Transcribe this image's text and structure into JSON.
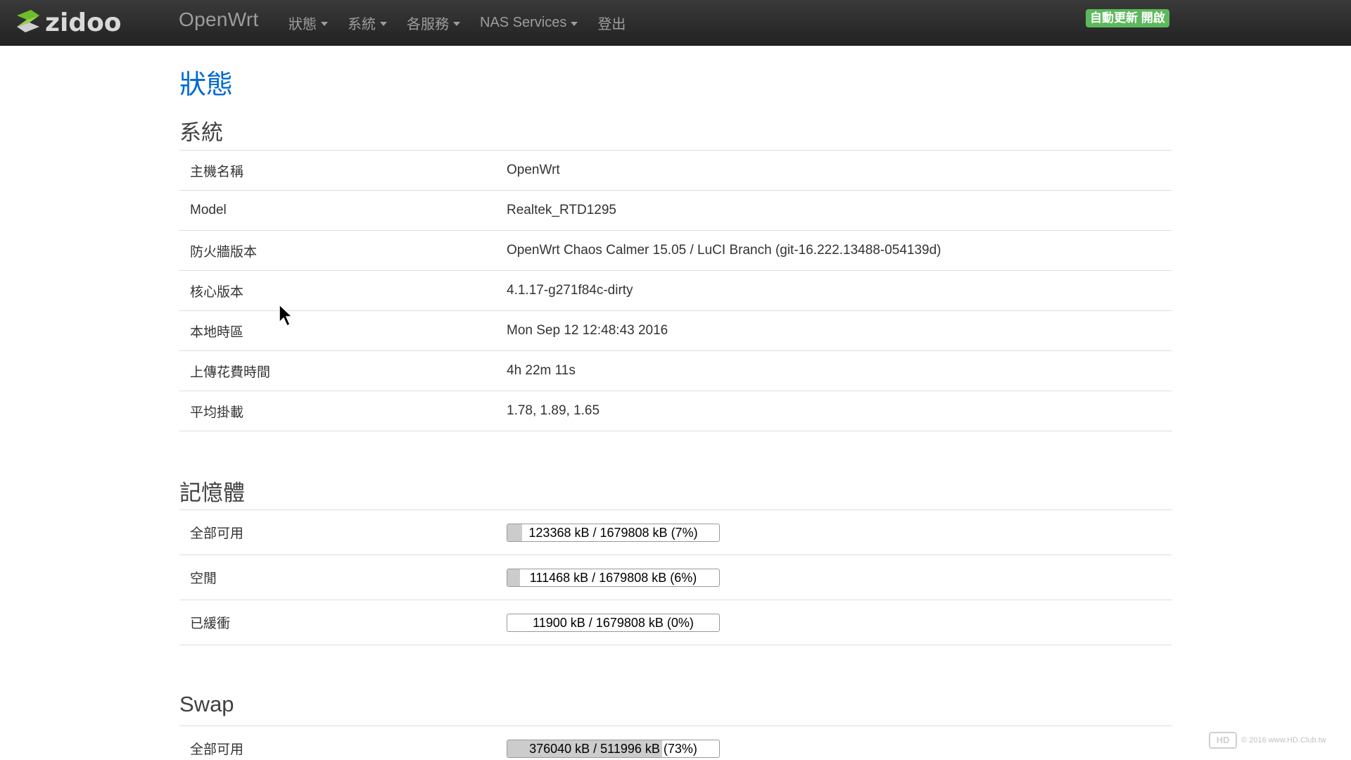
{
  "navbar": {
    "brand_logo_text": "zidoo",
    "brand_text": "OpenWrt",
    "menu": [
      {
        "label": "狀態",
        "has_caret": true
      },
      {
        "label": "系統",
        "has_caret": true
      },
      {
        "label": "各服務",
        "has_caret": true
      },
      {
        "label": "NAS Services",
        "has_caret": true
      },
      {
        "label": "登出",
        "has_caret": false
      }
    ],
    "auto_refresh_label": "自動更新 開啟"
  },
  "page": {
    "title": "狀態"
  },
  "system": {
    "title": "系統",
    "rows": [
      {
        "key": "主機名稱",
        "value": "OpenWrt"
      },
      {
        "key": "Model",
        "value": "Realtek_RTD1295"
      },
      {
        "key": "防火牆版本",
        "value": "OpenWrt Chaos Calmer 15.05 / LuCI Branch (git-16.222.13488-054139d)"
      },
      {
        "key": "核心版本",
        "value": "4.1.17-g271f84c-dirty"
      },
      {
        "key": "本地時區",
        "value": "Mon Sep 12 12:48:43 2016"
      },
      {
        "key": "上傳花費時間",
        "value": "4h 22m 11s"
      },
      {
        "key": "平均掛載",
        "value": "1.78, 1.89, 1.65"
      }
    ]
  },
  "memory": {
    "title": "記憶體",
    "rows": [
      {
        "key": "全部可用",
        "value": "123368 kB / 1679808 kB (7%)",
        "fraction": 0.07
      },
      {
        "key": "空閒",
        "value": "111468 kB / 1679808 kB (6%)",
        "fraction": 0.06
      },
      {
        "key": "已緩衝",
        "value": "11900 kB / 1679808 kB (0%)",
        "fraction": 0.0
      }
    ]
  },
  "swap": {
    "title": "Swap",
    "rows": [
      {
        "key": "全部可用",
        "value": "376040 kB / 511996 kB (73%)",
        "fraction": 0.73
      }
    ]
  },
  "watermark": {
    "badge": "HD",
    "text": "© 2016 www.HD.Club.tw"
  },
  "colors": {
    "navbar_bg": "#222222",
    "accent_title": "#0069d6",
    "auto_refresh_bg": "#5cb85c",
    "bar_fill": "#cccccc"
  }
}
